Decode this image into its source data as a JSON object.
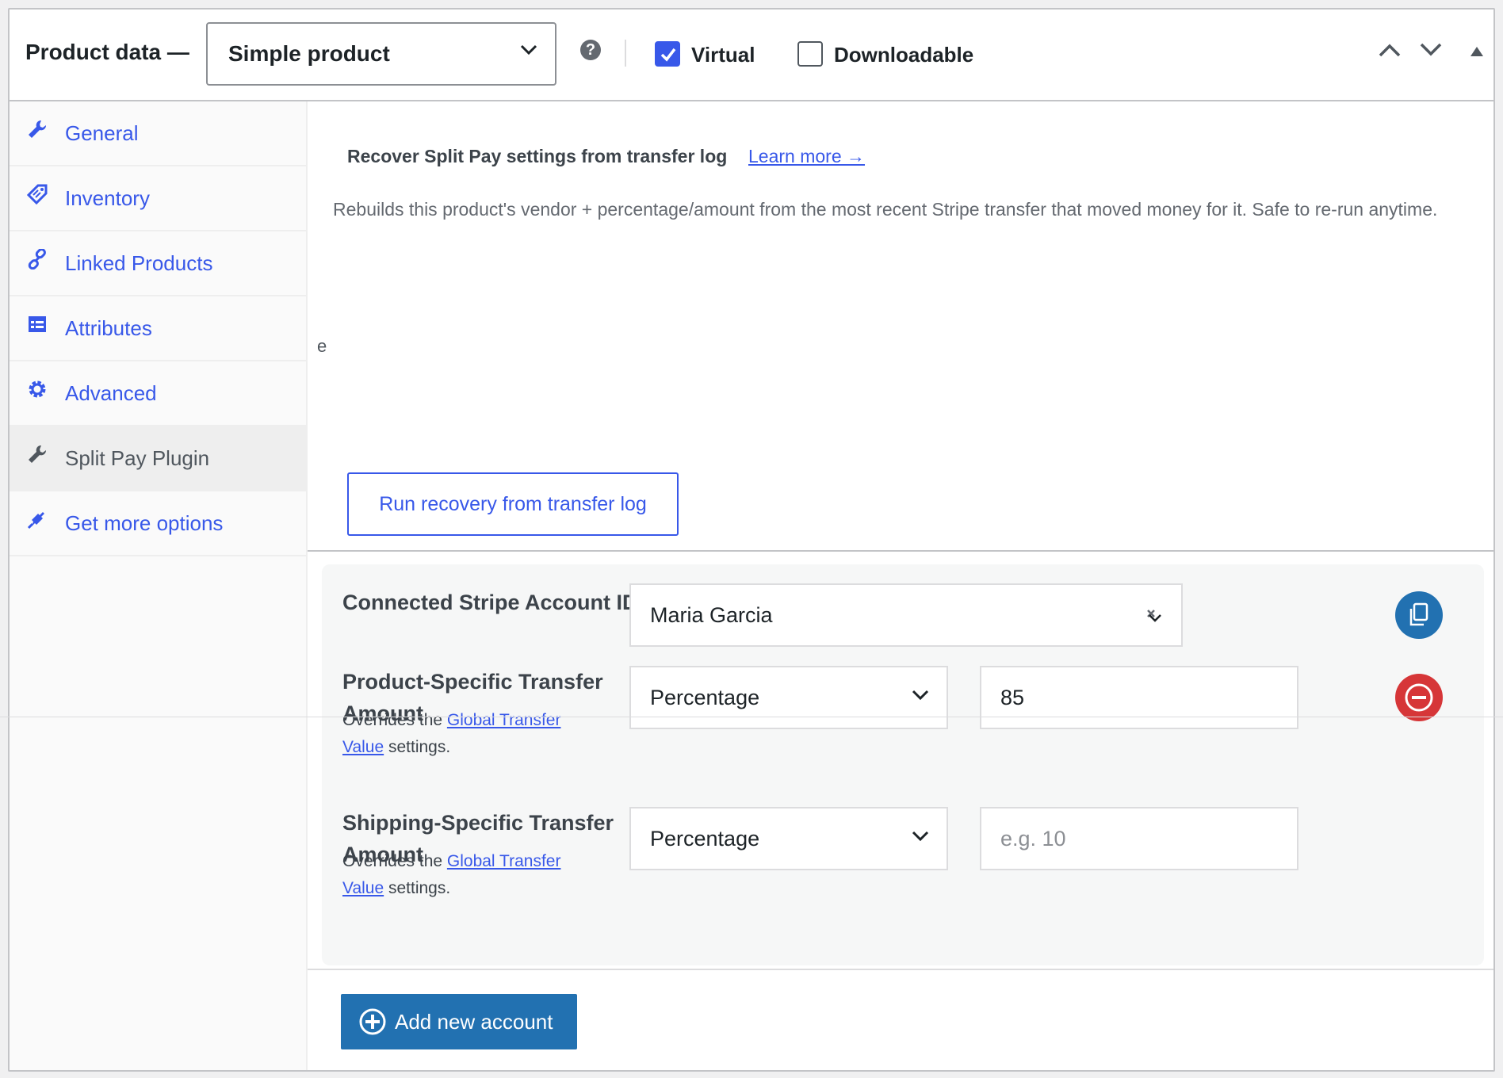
{
  "header": {
    "title": "Product data —",
    "product_type": "Simple product",
    "help": "?",
    "virtual_label": "Virtual",
    "virtual_checked": true,
    "downloadable_label": "Downloadable",
    "downloadable_checked": false
  },
  "sidebar": {
    "items": [
      {
        "label": "General",
        "icon": "wrench-icon"
      },
      {
        "label": "Inventory",
        "icon": "tag-icon"
      },
      {
        "label": "Linked Products",
        "icon": "link-icon"
      },
      {
        "label": "Attributes",
        "icon": "list-table-icon"
      },
      {
        "label": "Advanced",
        "icon": "gear-icon"
      },
      {
        "label": "Split Pay Plugin",
        "icon": "wrench-icon",
        "active": true
      },
      {
        "label": "Get more options",
        "icon": "plugin-icon"
      }
    ]
  },
  "recovery": {
    "title": "Recover Split Pay settings from transfer log",
    "learn_more": "Learn more →",
    "description": "Rebuilds this product's vendor + percentage/amount from the most recent Stripe transfer that moved money for it. Safe to re-run anytime.",
    "stray_char": "e",
    "run_button": "Run recovery from transfer log"
  },
  "account": {
    "stripe_label": "Connected Stripe Account ID",
    "stripe_value": "Maria Garcia",
    "product_label_line1": "Product-Specific Transfer",
    "product_label_line2": "Amount",
    "product_type": "Percentage",
    "product_value": "85",
    "help_prefix": "Overrides the ",
    "help_link_line1": "Global Transfer",
    "help_link_line2": "Value",
    "help_suffix": " settings.",
    "shipping_label_line1": "Shipping-Specific Transfer",
    "shipping_label_line2": "Amount",
    "shipping_type": "Percentage",
    "shipping_placeholder": "e.g. 10"
  },
  "footer": {
    "add_button": "Add new account"
  },
  "colors": {
    "accent": "#3858e9",
    "primary_button": "#2271b1",
    "remove_button": "#d63638"
  }
}
